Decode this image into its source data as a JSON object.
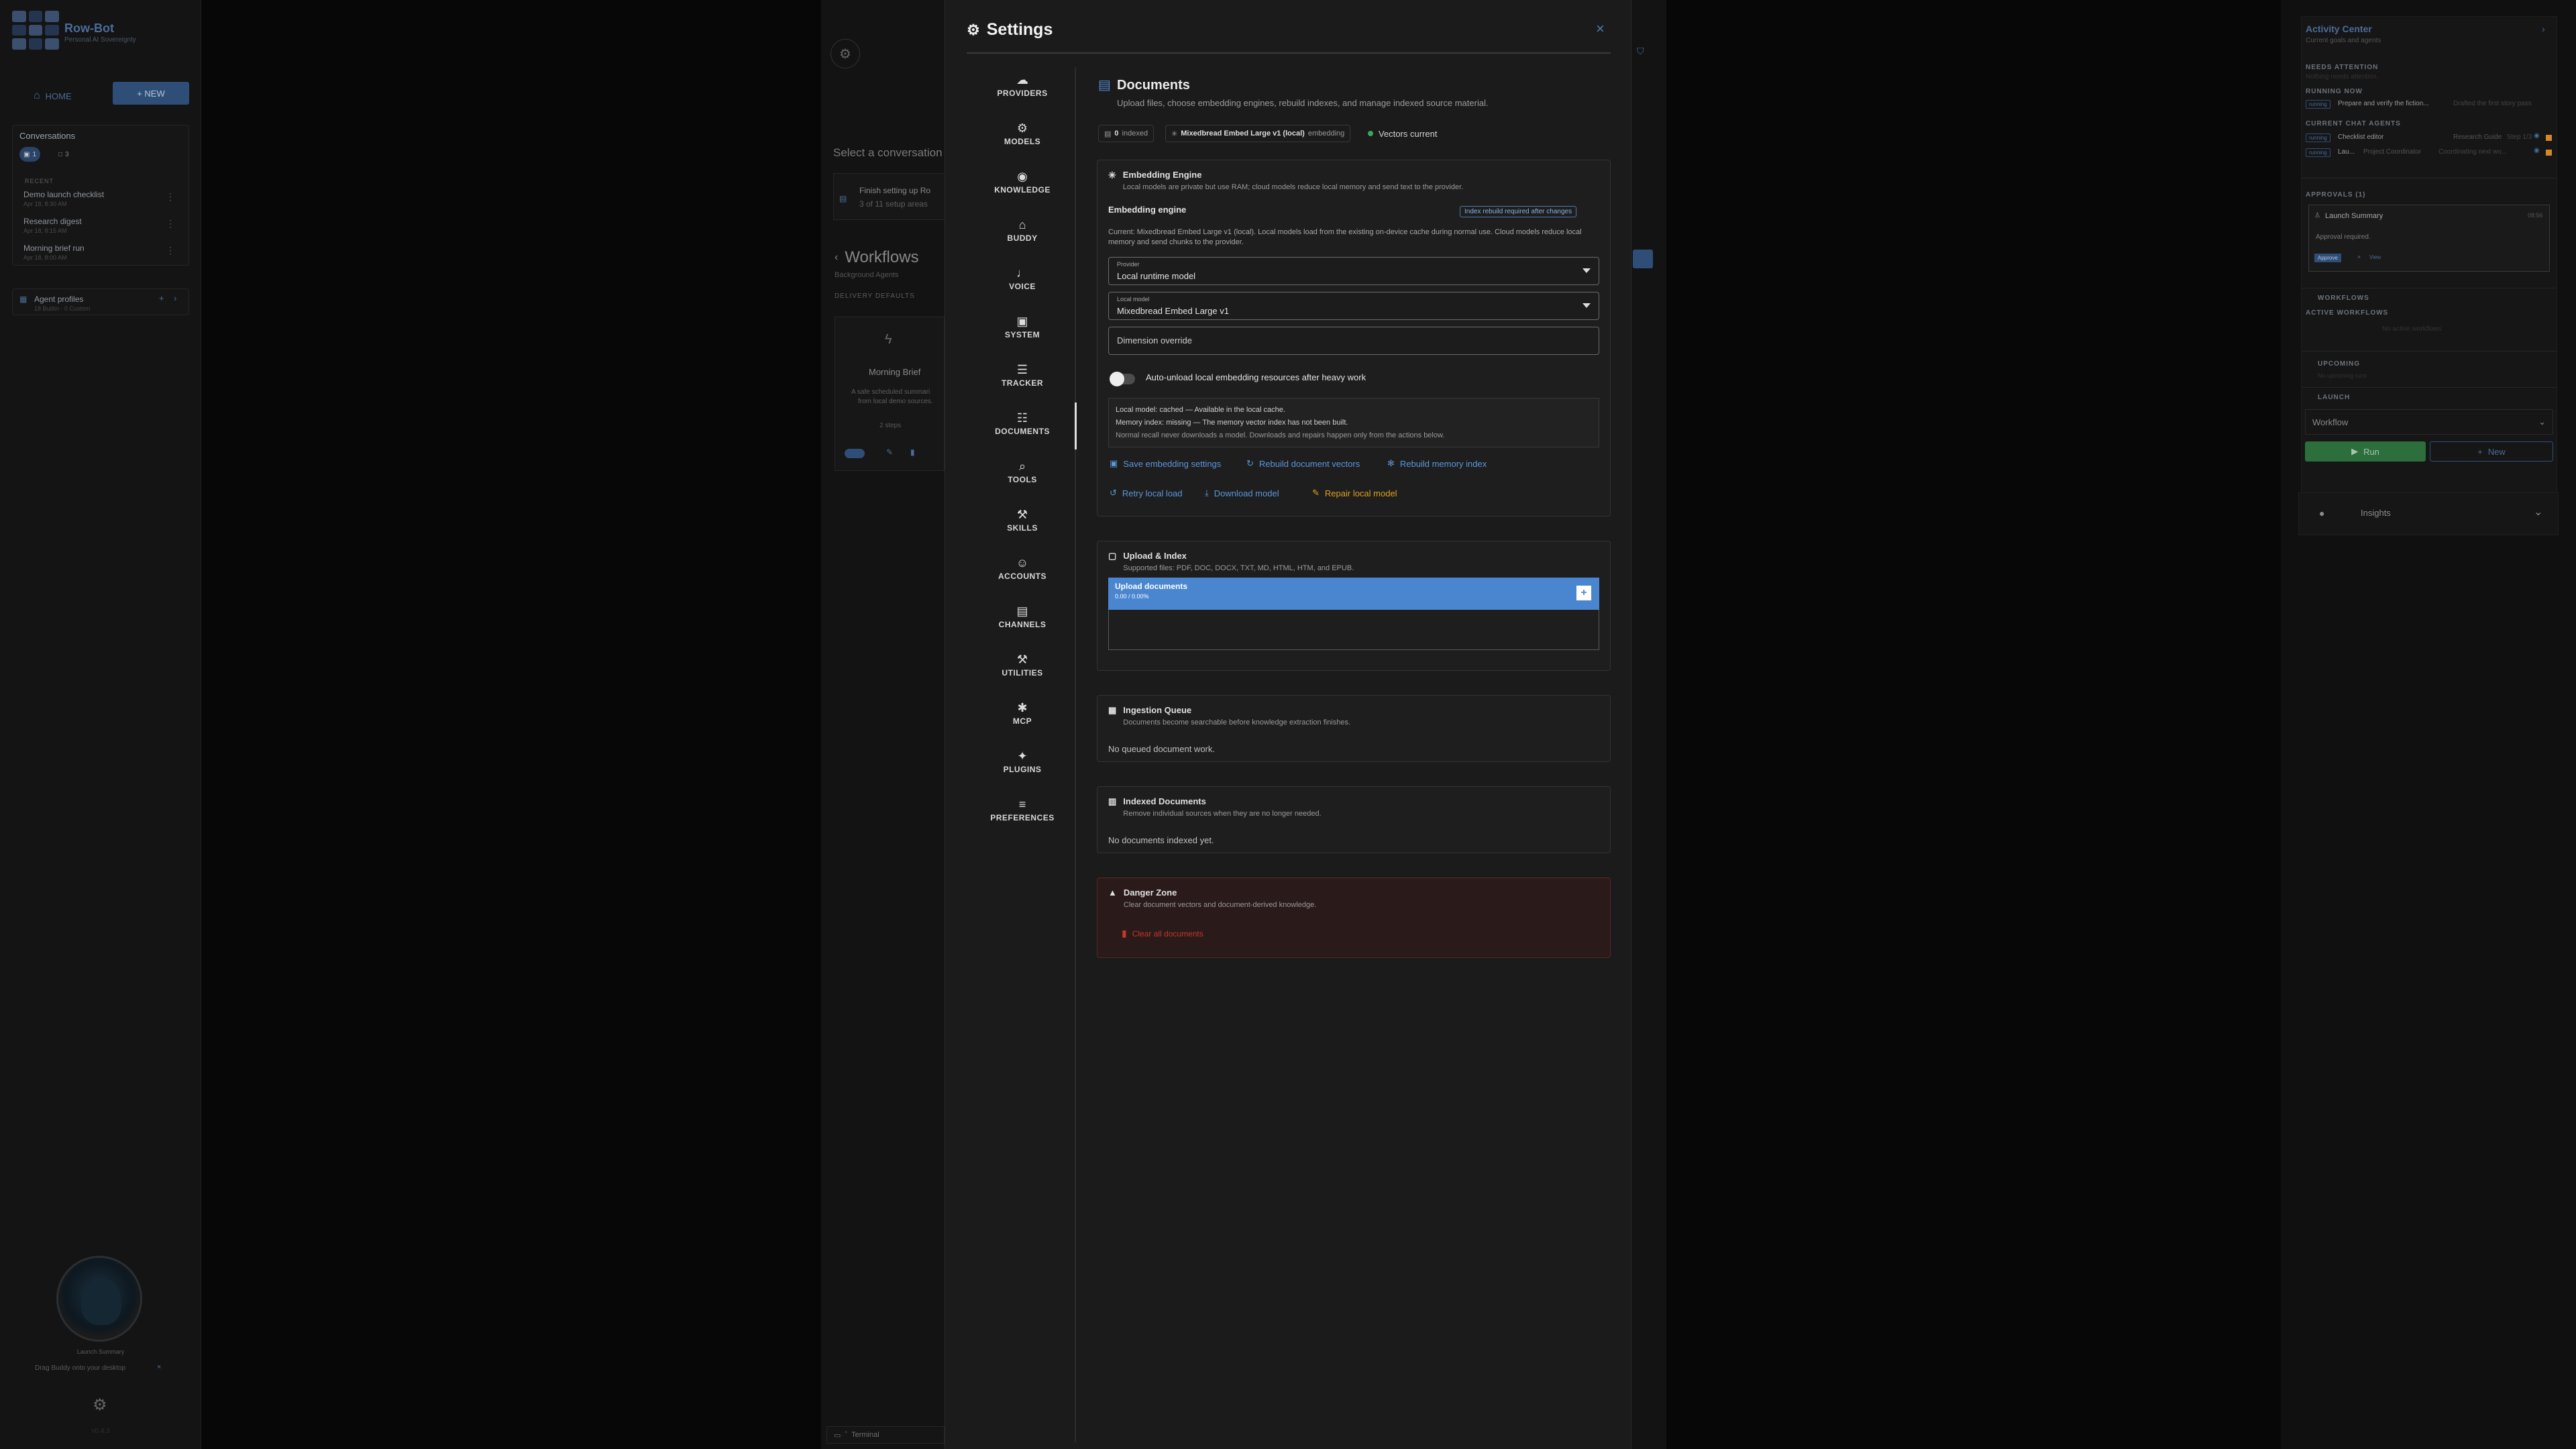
{
  "brand": {
    "title": "Row-Bot",
    "subtitle": "Personal AI Sovereignty"
  },
  "left": {
    "home_label": "HOME",
    "new_label": "+ NEW",
    "conversations_title": "Conversations",
    "chip_count_a": "1",
    "chip_count_b": "3",
    "recent_label": "RECENT",
    "items": [
      {
        "title": "Demo launch checklist",
        "date": "Apr 18, 8:30 AM"
      },
      {
        "title": "Research digest",
        "date": "Apr 18, 8:15 AM"
      },
      {
        "title": "Morning brief run",
        "date": "Apr 18, 8:00 AM"
      }
    ],
    "agent_profiles": "Agent profiles",
    "agent_profiles_sub": "18 Builtin · 0 Custom",
    "launch_summary": "Launch Summary",
    "drag_hint": "Drag Buddy onto your desktop",
    "version": "v0.4.3"
  },
  "mid": {
    "select_conversation": "Select a conversation",
    "setup_title": "Finish setting up Ro",
    "setup_sub": "3 of 11 setup areas",
    "workflows_title": "Workflows",
    "workflows_sub": "Background Agents",
    "delivery_defaults": "DELIVERY DEFAULTS",
    "card_title": "Morning Brief",
    "card_desc_1": "A safe scheduled summari",
    "card_desc_2": "from local demo sources.",
    "card_steps": "2 steps",
    "terminal": "Terminal"
  },
  "right": {
    "activity_title": "Activity Center",
    "activity_sub": "Current goals and agents",
    "needs_attention": "NEEDS ATTENTION",
    "needs_attention_empty": "Nothing needs attention.",
    "running_now": "RUNNING NOW",
    "running_badge": "running",
    "running_item": "Prepare and verify the fiction...",
    "running_item_sub": "Drafted the first story pass",
    "current_chat_agents": "CURRENT CHAT AGENTS",
    "agent1_badge": "running",
    "agent1_name": "Checklist editor",
    "agent1_role": "Research Guide",
    "agent1_step": "Step 1/3",
    "agent2_badge": "running",
    "agent2_name": "Lau...",
    "agent2_role": "Project Coordinator",
    "agent2_step": "Coordinating next wo...",
    "approvals": "APPROVALS (1)",
    "approval_item": "Launch Summary",
    "approval_time": "08:56",
    "approval_note": "Approval required.",
    "approve": "Approve",
    "view": "View",
    "workflows": "WORKFLOWS",
    "active_workflows": "ACTIVE WORKFLOWS",
    "no_active": "No active workflows",
    "upcoming": "UPCOMING",
    "upcoming_empty": "No upcoming runs",
    "launch": "LAUNCH",
    "workflow_select": "Workflow",
    "run": "Run",
    "new": "New",
    "insights": "Insights"
  },
  "settings": {
    "title": "Settings",
    "close": "×",
    "nav": [
      {
        "label": "PROVIDERS",
        "icon": "☁"
      },
      {
        "label": "MODELS",
        "icon": "⚙"
      },
      {
        "label": "KNOWLEDGE",
        "icon": "◉"
      },
      {
        "label": "BUDDY",
        "icon": "⌂"
      },
      {
        "label": "VOICE",
        "icon": "♩"
      },
      {
        "label": "SYSTEM",
        "icon": "▣"
      },
      {
        "label": "TRACKER",
        "icon": "☰"
      },
      {
        "label": "DOCUMENTS",
        "icon": "☷"
      },
      {
        "label": "TOOLS",
        "icon": "⌕"
      },
      {
        "label": "SKILLS",
        "icon": "⚒"
      },
      {
        "label": "ACCOUNTS",
        "icon": "☺"
      },
      {
        "label": "CHANNELS",
        "icon": "▤"
      },
      {
        "label": "UTILITIES",
        "icon": "⚒"
      },
      {
        "label": "MCP",
        "icon": "✱"
      },
      {
        "label": "PLUGINS",
        "icon": "✦"
      },
      {
        "label": "PREFERENCES",
        "icon": "≡"
      }
    ],
    "active_nav": "DOCUMENTS",
    "documents": {
      "title": "Documents",
      "subtitle": "Upload files, choose embedding engines, rebuild indexes, and manage indexed source material.",
      "indexed_count": "0",
      "indexed_label": "indexed",
      "model_chip": "Mixedbread Embed Large v1 (local)",
      "model_chip_suffix": "embedding",
      "vectors_status": "Vectors current"
    },
    "embedding": {
      "title": "Embedding Engine",
      "subtitle": "Local models are private but use RAM; cloud models reduce local memory and send text to the provider.",
      "label": "Embedding engine",
      "rebuild_note": "Index rebuild required after changes",
      "current_text": "Current: Mixedbread Embed Large v1 (local). Local models load from the existing on-device cache during normal use. Cloud models reduce local memory and send chunks to the provider.",
      "provider_label": "Provider",
      "provider_value": "Local runtime model",
      "local_model_label": "Local model",
      "local_model_value": "Mixedbread Embed Large v1",
      "dimension_placeholder": "Dimension override",
      "toggle_label": "Auto-unload local embedding resources after heavy work",
      "info_line1": "Local model: cached — Available in the local cache.",
      "info_line2": "Memory index: missing — The memory vector index has not been built.",
      "info_line3": "Normal recall never downloads a model. Downloads and repairs happen only from the actions below.",
      "save": "Save embedding settings",
      "rebuild_docs": "Rebuild document vectors",
      "rebuild_memory": "Rebuild memory index",
      "retry": "Retry local load",
      "download": "Download model",
      "repair": "Repair local model"
    },
    "upload": {
      "title": "Upload & Index",
      "subtitle": "Supported files: PDF, DOC, DOCX, TXT, MD, HTML, HTM, and EPUB.",
      "bar_title": "Upload documents",
      "bar_size": "0.00 / 0.00%"
    },
    "queue": {
      "title": "Ingestion Queue",
      "subtitle": "Documents become searchable before knowledge extraction finishes.",
      "empty": "No queued document work."
    },
    "indexed": {
      "title": "Indexed Documents",
      "subtitle": "Remove individual sources when they are no longer needed.",
      "empty": "No documents indexed yet."
    },
    "danger": {
      "title": "Danger Zone",
      "subtitle": "Clear document vectors and document-derived knowledge.",
      "clear": "Clear all documents"
    }
  },
  "colors": {
    "accent": "#4f86c6",
    "danger": "#c0392b",
    "warning": "#e0a21a",
    "success": "#3fa35a"
  }
}
